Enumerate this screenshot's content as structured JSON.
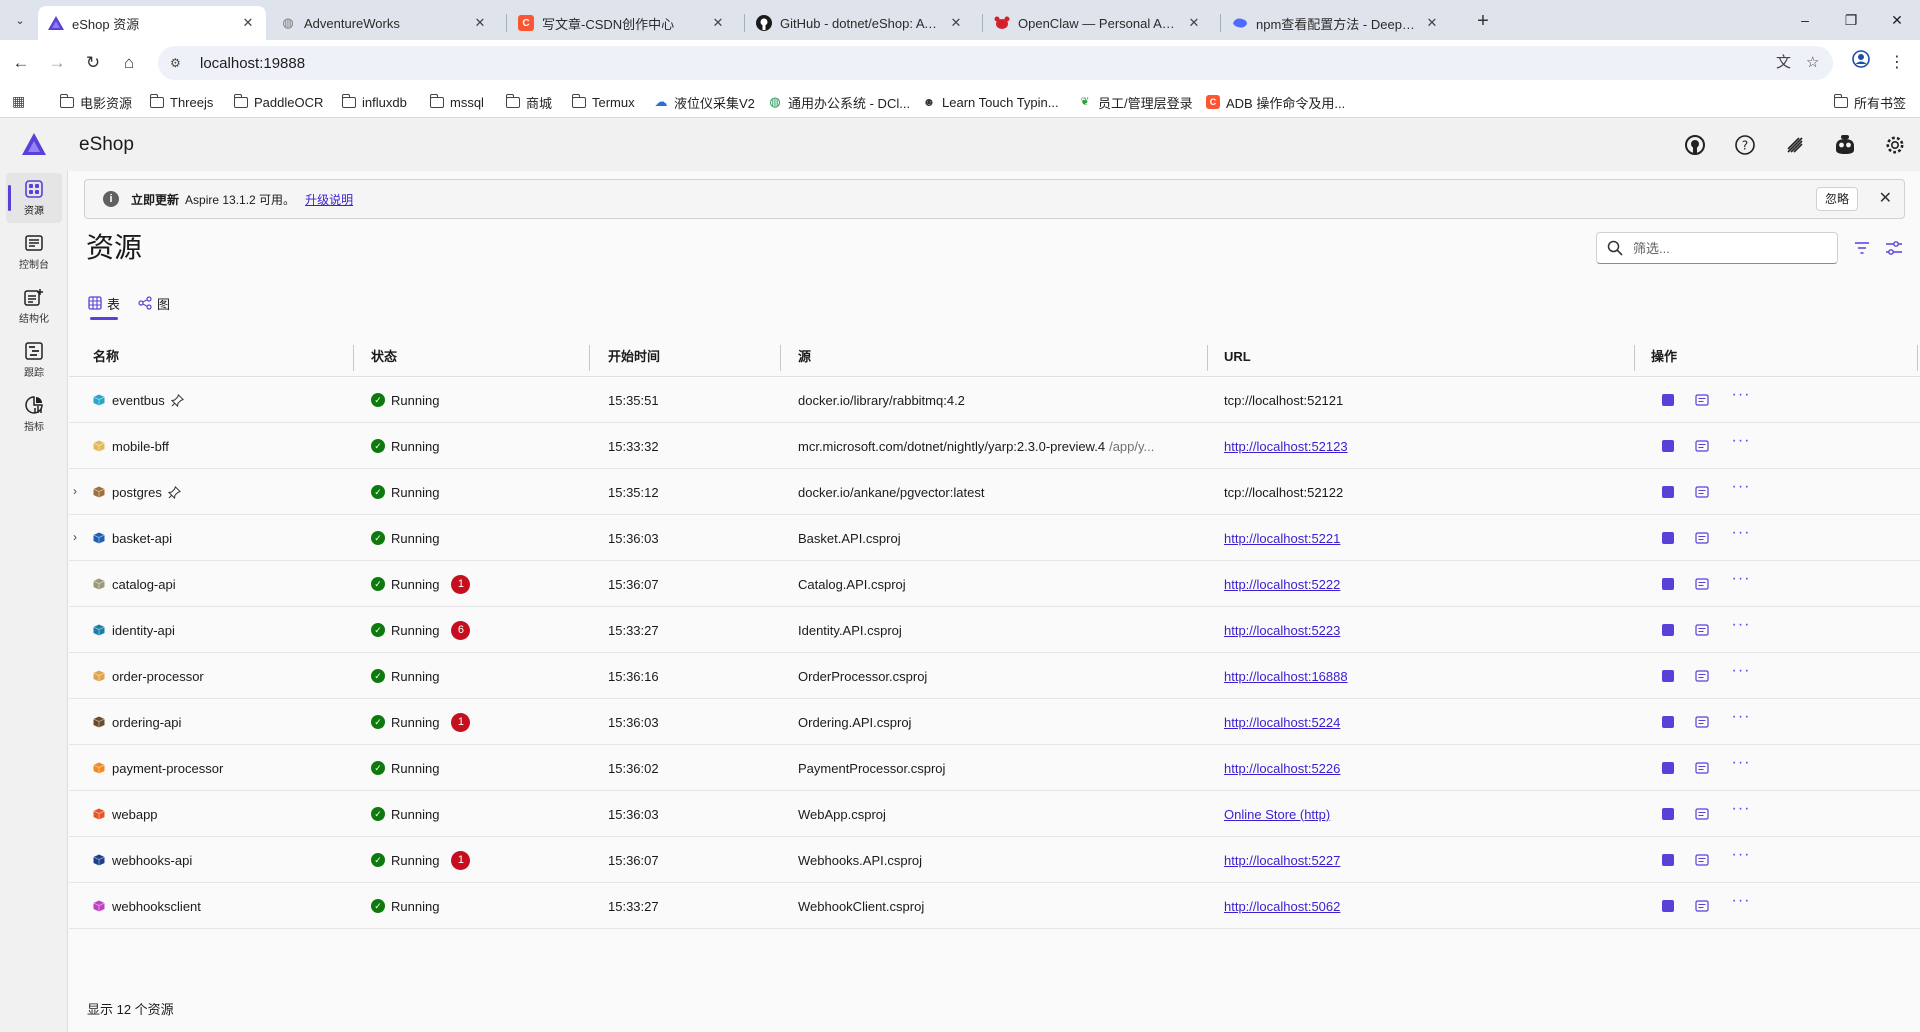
{
  "browser": {
    "tabs": [
      {
        "title": "eShop 资源",
        "favicon": "aspire-logo",
        "color": "#5b3fd9"
      },
      {
        "title": "AdventureWorks",
        "favicon": "globe",
        "color": "#777777"
      },
      {
        "title": "写文章-CSDN创作中心",
        "favicon": "csdn-c",
        "color": "#fc5531"
      },
      {
        "title": "GitHub - dotnet/eShop: A reference",
        "favicon": "github",
        "color": "#1b1b1b"
      },
      {
        "title": "OpenClaw — Personal AI Assistant",
        "favicon": "openclaw",
        "color": "#d4202a"
      },
      {
        "title": "npm查看配置方法 - DeepSeek",
        "favicon": "deepseek",
        "color": "#4d6bfe"
      }
    ],
    "url": "localhost:19888",
    "bookmarks": [
      {
        "label": "电影资源",
        "kind": "folder"
      },
      {
        "label": "Threejs",
        "kind": "folder"
      },
      {
        "label": "PaddleOCR",
        "kind": "folder"
      },
      {
        "label": "influxdb",
        "kind": "folder"
      },
      {
        "label": "mssql",
        "kind": "folder"
      },
      {
        "label": "商城",
        "kind": "folder"
      },
      {
        "label": "Termux",
        "kind": "folder"
      },
      {
        "label": "液位仪采集V2",
        "kind": "cloud-icon"
      },
      {
        "label": "通用办公系统 - DCl...",
        "kind": "globe-icon"
      },
      {
        "label": "Learn Touch Typin...",
        "kind": "keybr-icon"
      },
      {
        "label": "员工/管理层登录",
        "kind": "leaf-icon"
      },
      {
        "label": "ADB 操作命令及用...",
        "kind": "csdn-icon"
      }
    ],
    "all_bookmarks": "所有书签"
  },
  "app": {
    "title": "eShop",
    "accent": "#5b3fd9",
    "sidebar": [
      {
        "label": "资源",
        "icon": "resources-icon"
      },
      {
        "label": "控制台",
        "icon": "console-icon"
      },
      {
        "label": "结构化",
        "icon": "structured-logs-icon"
      },
      {
        "label": "跟踪",
        "icon": "traces-icon"
      },
      {
        "label": "指标",
        "icon": "metrics-icon"
      }
    ],
    "banner": {
      "strong": "立即更新",
      "text": "Aspire 13.1.2 可用。",
      "link": "升级说明",
      "dismiss": "忽略"
    },
    "page_title": "资源",
    "filter_placeholder": "筛选...",
    "view_tabs": {
      "table": "表",
      "graph": "图"
    },
    "columns": {
      "name": "名称",
      "state": "状态",
      "start": "开始时间",
      "source": "源",
      "url": "URL",
      "actions": "操作"
    },
    "resources": [
      {
        "name": "eventbus",
        "icon_color": "#2aa5c7",
        "icon": "container-icon",
        "expandable": false,
        "pinned": true,
        "state": "Running",
        "errors": "",
        "start": "15:35:51",
        "source": "docker.io/library/rabbitmq:4.2",
        "source_args": "",
        "url": "tcp://localhost:52121",
        "url_link": false
      },
      {
        "name": "mobile-bff",
        "icon_color": "#e3b95c",
        "icon": "container-icon",
        "expandable": false,
        "pinned": false,
        "state": "Running",
        "errors": "",
        "start": "15:33:32",
        "source": "mcr.microsoft.com/dotnet/nightly/yarp:2.3.0-preview.4",
        "source_args": "/app/y...",
        "url": "http://localhost:52123",
        "url_link": true
      },
      {
        "name": "postgres",
        "icon_color": "#a0703c",
        "icon": "container-icon",
        "expandable": true,
        "pinned": true,
        "state": "Running",
        "errors": "",
        "start": "15:35:12",
        "source": "docker.io/ankane/pgvector:latest",
        "source_args": "",
        "url": "tcp://localhost:52122",
        "url_link": false
      },
      {
        "name": "basket-api",
        "icon_color": "#1e5fb3",
        "icon": "csharp-project-icon",
        "expandable": true,
        "pinned": false,
        "state": "Running",
        "errors": "",
        "start": "15:36:03",
        "source": "Basket.API.csproj",
        "source_args": "",
        "url": "http://localhost:5221",
        "url_link": true
      },
      {
        "name": "catalog-api",
        "icon_color": "#9a9a7a",
        "icon": "csharp-project-icon",
        "expandable": false,
        "pinned": false,
        "state": "Running",
        "errors": "1",
        "start": "15:36:07",
        "source": "Catalog.API.csproj",
        "source_args": "",
        "url": "http://localhost:5222",
        "url_link": true
      },
      {
        "name": "identity-api",
        "icon_color": "#1b7fa8",
        "icon": "csharp-project-icon",
        "expandable": false,
        "pinned": false,
        "state": "Running",
        "errors": "6",
        "start": "15:33:27",
        "source": "Identity.API.csproj",
        "source_args": "",
        "url": "http://localhost:5223",
        "url_link": true
      },
      {
        "name": "order-processor",
        "icon_color": "#e0a44a",
        "icon": "csharp-project-icon",
        "expandable": false,
        "pinned": false,
        "state": "Running",
        "errors": "",
        "start": "15:36:16",
        "source": "OrderProcessor.csproj",
        "source_args": "",
        "url": "http://localhost:16888",
        "url_link": true
      },
      {
        "name": "ordering-api",
        "icon_color": "#6b4a2a",
        "icon": "csharp-project-icon",
        "expandable": false,
        "pinned": false,
        "state": "Running",
        "errors": "1",
        "start": "15:36:03",
        "source": "Ordering.API.csproj",
        "source_args": "",
        "url": "http://localhost:5224",
        "url_link": true
      },
      {
        "name": "payment-processor",
        "icon_color": "#f08a24",
        "icon": "csharp-project-icon",
        "expandable": false,
        "pinned": false,
        "state": "Running",
        "errors": "",
        "start": "15:36:02",
        "source": "PaymentProcessor.csproj",
        "source_args": "",
        "url": "http://localhost:5226",
        "url_link": true
      },
      {
        "name": "webapp",
        "icon_color": "#e8542a",
        "icon": "csharp-project-icon",
        "expandable": false,
        "pinned": false,
        "state": "Running",
        "errors": "",
        "start": "15:36:03",
        "source": "WebApp.csproj",
        "source_args": "",
        "url": "Online Store (http)",
        "url_link": true
      },
      {
        "name": "webhooks-api",
        "icon_color": "#1e3f8a",
        "icon": "csharp-project-icon",
        "expandable": false,
        "pinned": false,
        "state": "Running",
        "errors": "1",
        "start": "15:36:07",
        "source": "Webhooks.API.csproj",
        "source_args": "",
        "url": "http://localhost:5227",
        "url_link": true
      },
      {
        "name": "webhooksclient",
        "icon_color": "#c040c0",
        "icon": "csharp-project-icon",
        "expandable": false,
        "pinned": false,
        "state": "Running",
        "errors": "",
        "start": "15:33:27",
        "source": "WebhookClient.csproj",
        "source_args": "",
        "url": "http://localhost:5062",
        "url_link": true
      }
    ],
    "footer": "显示 12 个资源"
  }
}
